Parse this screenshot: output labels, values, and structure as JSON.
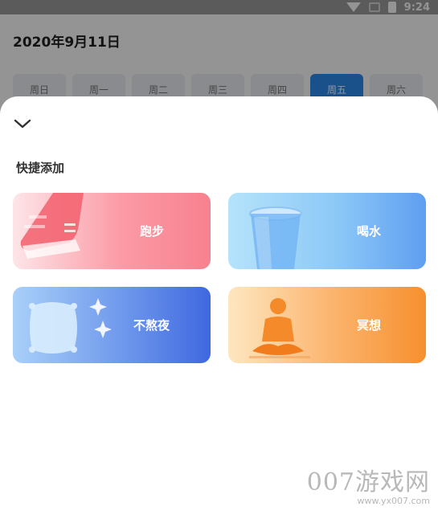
{
  "status_bar": {
    "time": "9:24"
  },
  "header": {
    "date": "2020年9月11日"
  },
  "weekdays": [
    "周日",
    "周一",
    "周二",
    "周三",
    "周四",
    "周五",
    "周六"
  ],
  "active_weekday": "周五",
  "sheet": {
    "section_title": "快捷添加",
    "cards": [
      {
        "label": "跑步",
        "icon": "shoe-icon"
      },
      {
        "label": "喝水",
        "icon": "water-glass-icon"
      },
      {
        "label": "不熬夜",
        "icon": "pillow-icon"
      },
      {
        "label": "冥想",
        "icon": "meditation-icon"
      }
    ]
  },
  "watermark": {
    "main": "007游戏网",
    "sub": "www.yx007.com"
  },
  "colors": {
    "run": "#f7818f",
    "water": "#5f9ef1",
    "sleep": "#4068e0",
    "meditate": "#f7902f",
    "accent": "#2f8cf0"
  }
}
